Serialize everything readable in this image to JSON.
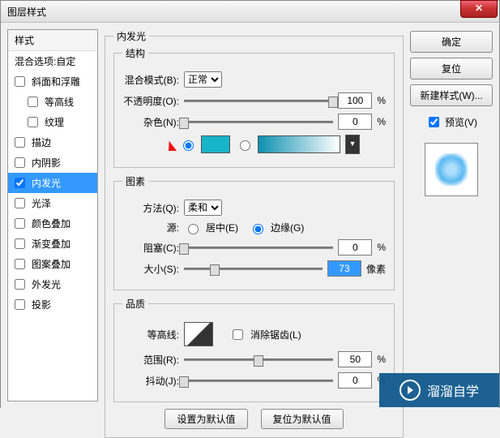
{
  "window": {
    "title": "图层样式"
  },
  "leftPanel": {
    "header": "样式",
    "blendHeader": "混合选项:自定",
    "items": [
      {
        "label": "斜面和浮雕",
        "checked": false,
        "indent": false
      },
      {
        "label": "等高线",
        "checked": false,
        "indent": true
      },
      {
        "label": "纹理",
        "checked": false,
        "indent": true
      },
      {
        "label": "描边",
        "checked": false,
        "indent": false
      },
      {
        "label": "内阴影",
        "checked": false,
        "indent": false
      },
      {
        "label": "内发光",
        "checked": true,
        "indent": false,
        "selected": true
      },
      {
        "label": "光泽",
        "checked": false,
        "indent": false
      },
      {
        "label": "颜色叠加",
        "checked": false,
        "indent": false
      },
      {
        "label": "渐变叠加",
        "checked": false,
        "indent": false
      },
      {
        "label": "图案叠加",
        "checked": false,
        "indent": false
      },
      {
        "label": "外发光",
        "checked": false,
        "indent": false
      },
      {
        "label": "投影",
        "checked": false,
        "indent": false
      }
    ]
  },
  "center": {
    "groupTitle": "内发光",
    "struct": {
      "legend": "结构",
      "blendModeLabel": "混合模式(B):",
      "blendModeValue": "正常",
      "opacityLabel": "不透明度(O):",
      "opacityValue": "100",
      "opacityUnit": "%",
      "noiseLabel": "杂色(N):",
      "noiseValue": "0",
      "noiseUnit": "%",
      "colorSwatch": "#18b4c9",
      "gradientFrom": "#0e90b0",
      "gradientTo": "#ffffff"
    },
    "elements": {
      "legend": "图素",
      "techniqueLabel": "方法(Q):",
      "techniqueValue": "柔和",
      "sourceLabel": "源:",
      "sourceCenter": "居中(E)",
      "sourceEdge": "边缘(G)",
      "chokeLabel": "阻塞(C):",
      "chokeValue": "0",
      "chokeUnit": "%",
      "sizeLabel": "大小(S):",
      "sizeValue": "73",
      "sizeUnit": "像素"
    },
    "quality": {
      "legend": "品质",
      "contourLabel": "等高线:",
      "antiAliasLabel": "消除锯齿(L)",
      "rangeLabel": "范围(R):",
      "rangeValue": "50",
      "rangeUnit": "%",
      "jitterLabel": "抖动(J):",
      "jitterValue": "0",
      "jitterUnit": "%"
    },
    "bottom": {
      "setDefault": "设置为默认值",
      "resetDefault": "复位为默认值"
    }
  },
  "right": {
    "ok": "确定",
    "cancel": "复位",
    "newStyle": "新建样式(W)...",
    "previewLabel": "预览(V)"
  },
  "watermark": {
    "text": "溜溜自学"
  }
}
